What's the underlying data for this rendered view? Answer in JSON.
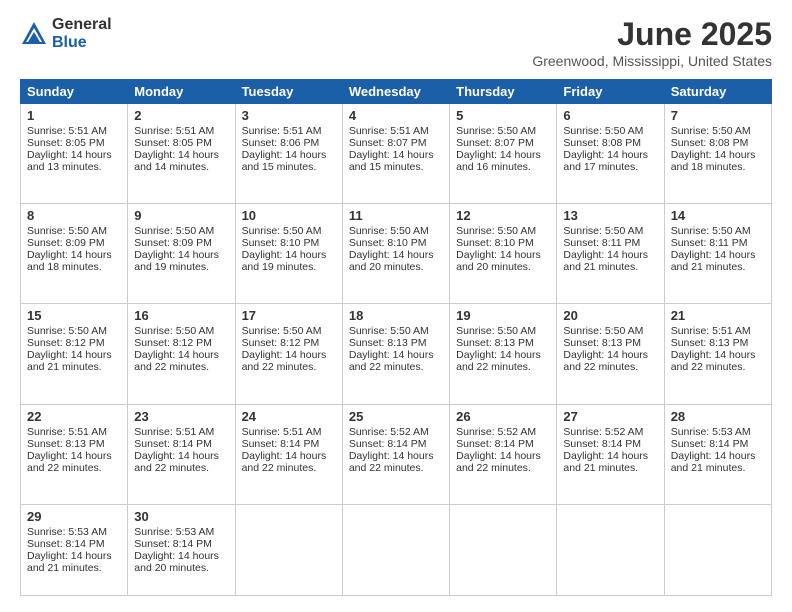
{
  "logo": {
    "general": "General",
    "blue": "Blue"
  },
  "header": {
    "title": "June 2025",
    "location": "Greenwood, Mississippi, United States"
  },
  "weekdays": [
    "Sunday",
    "Monday",
    "Tuesday",
    "Wednesday",
    "Thursday",
    "Friday",
    "Saturday"
  ],
  "weeks": [
    [
      {
        "day": "1",
        "lines": [
          "Sunrise: 5:51 AM",
          "Sunset: 8:05 PM",
          "Daylight: 14 hours",
          "and 13 minutes."
        ]
      },
      {
        "day": "2",
        "lines": [
          "Sunrise: 5:51 AM",
          "Sunset: 8:05 PM",
          "Daylight: 14 hours",
          "and 14 minutes."
        ]
      },
      {
        "day": "3",
        "lines": [
          "Sunrise: 5:51 AM",
          "Sunset: 8:06 PM",
          "Daylight: 14 hours",
          "and 15 minutes."
        ]
      },
      {
        "day": "4",
        "lines": [
          "Sunrise: 5:51 AM",
          "Sunset: 8:07 PM",
          "Daylight: 14 hours",
          "and 15 minutes."
        ]
      },
      {
        "day": "5",
        "lines": [
          "Sunrise: 5:50 AM",
          "Sunset: 8:07 PM",
          "Daylight: 14 hours",
          "and 16 minutes."
        ]
      },
      {
        "day": "6",
        "lines": [
          "Sunrise: 5:50 AM",
          "Sunset: 8:08 PM",
          "Daylight: 14 hours",
          "and 17 minutes."
        ]
      },
      {
        "day": "7",
        "lines": [
          "Sunrise: 5:50 AM",
          "Sunset: 8:08 PM",
          "Daylight: 14 hours",
          "and 18 minutes."
        ]
      }
    ],
    [
      {
        "day": "8",
        "lines": [
          "Sunrise: 5:50 AM",
          "Sunset: 8:09 PM",
          "Daylight: 14 hours",
          "and 18 minutes."
        ]
      },
      {
        "day": "9",
        "lines": [
          "Sunrise: 5:50 AM",
          "Sunset: 8:09 PM",
          "Daylight: 14 hours",
          "and 19 minutes."
        ]
      },
      {
        "day": "10",
        "lines": [
          "Sunrise: 5:50 AM",
          "Sunset: 8:10 PM",
          "Daylight: 14 hours",
          "and 19 minutes."
        ]
      },
      {
        "day": "11",
        "lines": [
          "Sunrise: 5:50 AM",
          "Sunset: 8:10 PM",
          "Daylight: 14 hours",
          "and 20 minutes."
        ]
      },
      {
        "day": "12",
        "lines": [
          "Sunrise: 5:50 AM",
          "Sunset: 8:10 PM",
          "Daylight: 14 hours",
          "and 20 minutes."
        ]
      },
      {
        "day": "13",
        "lines": [
          "Sunrise: 5:50 AM",
          "Sunset: 8:11 PM",
          "Daylight: 14 hours",
          "and 21 minutes."
        ]
      },
      {
        "day": "14",
        "lines": [
          "Sunrise: 5:50 AM",
          "Sunset: 8:11 PM",
          "Daylight: 14 hours",
          "and 21 minutes."
        ]
      }
    ],
    [
      {
        "day": "15",
        "lines": [
          "Sunrise: 5:50 AM",
          "Sunset: 8:12 PM",
          "Daylight: 14 hours",
          "and 21 minutes."
        ]
      },
      {
        "day": "16",
        "lines": [
          "Sunrise: 5:50 AM",
          "Sunset: 8:12 PM",
          "Daylight: 14 hours",
          "and 22 minutes."
        ]
      },
      {
        "day": "17",
        "lines": [
          "Sunrise: 5:50 AM",
          "Sunset: 8:12 PM",
          "Daylight: 14 hours",
          "and 22 minutes."
        ]
      },
      {
        "day": "18",
        "lines": [
          "Sunrise: 5:50 AM",
          "Sunset: 8:13 PM",
          "Daylight: 14 hours",
          "and 22 minutes."
        ]
      },
      {
        "day": "19",
        "lines": [
          "Sunrise: 5:50 AM",
          "Sunset: 8:13 PM",
          "Daylight: 14 hours",
          "and 22 minutes."
        ]
      },
      {
        "day": "20",
        "lines": [
          "Sunrise: 5:50 AM",
          "Sunset: 8:13 PM",
          "Daylight: 14 hours",
          "and 22 minutes."
        ]
      },
      {
        "day": "21",
        "lines": [
          "Sunrise: 5:51 AM",
          "Sunset: 8:13 PM",
          "Daylight: 14 hours",
          "and 22 minutes."
        ]
      }
    ],
    [
      {
        "day": "22",
        "lines": [
          "Sunrise: 5:51 AM",
          "Sunset: 8:13 PM",
          "Daylight: 14 hours",
          "and 22 minutes."
        ]
      },
      {
        "day": "23",
        "lines": [
          "Sunrise: 5:51 AM",
          "Sunset: 8:14 PM",
          "Daylight: 14 hours",
          "and 22 minutes."
        ]
      },
      {
        "day": "24",
        "lines": [
          "Sunrise: 5:51 AM",
          "Sunset: 8:14 PM",
          "Daylight: 14 hours",
          "and 22 minutes."
        ]
      },
      {
        "day": "25",
        "lines": [
          "Sunrise: 5:52 AM",
          "Sunset: 8:14 PM",
          "Daylight: 14 hours",
          "and 22 minutes."
        ]
      },
      {
        "day": "26",
        "lines": [
          "Sunrise: 5:52 AM",
          "Sunset: 8:14 PM",
          "Daylight: 14 hours",
          "and 22 minutes."
        ]
      },
      {
        "day": "27",
        "lines": [
          "Sunrise: 5:52 AM",
          "Sunset: 8:14 PM",
          "Daylight: 14 hours",
          "and 21 minutes."
        ]
      },
      {
        "day": "28",
        "lines": [
          "Sunrise: 5:53 AM",
          "Sunset: 8:14 PM",
          "Daylight: 14 hours",
          "and 21 minutes."
        ]
      }
    ],
    [
      {
        "day": "29",
        "lines": [
          "Sunrise: 5:53 AM",
          "Sunset: 8:14 PM",
          "Daylight: 14 hours",
          "and 21 minutes."
        ]
      },
      {
        "day": "30",
        "lines": [
          "Sunrise: 5:53 AM",
          "Sunset: 8:14 PM",
          "Daylight: 14 hours",
          "and 20 minutes."
        ]
      },
      {
        "day": "",
        "lines": [],
        "empty": true
      },
      {
        "day": "",
        "lines": [],
        "empty": true
      },
      {
        "day": "",
        "lines": [],
        "empty": true
      },
      {
        "day": "",
        "lines": [],
        "empty": true
      },
      {
        "day": "",
        "lines": [],
        "empty": true
      }
    ]
  ]
}
